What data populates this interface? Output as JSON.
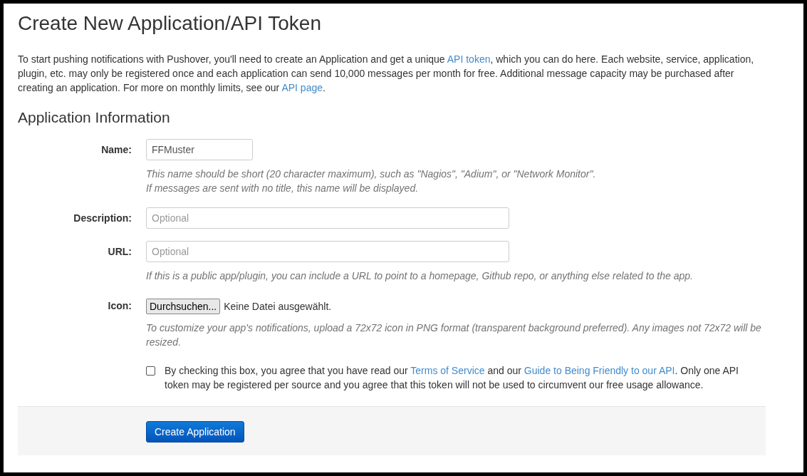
{
  "title": "Create New Application/API Token",
  "intro": [
    {
      "kind": "text",
      "text": "To start pushing notifications with Pushover, you'll need to create an Application and get a unique "
    },
    {
      "kind": "link",
      "text": "API token"
    },
    {
      "kind": "text",
      "text": ", which you can do here. Each website, service, application, plugin, etc. may only be registered once and each application can send 10,000 messages per month for free. Additional message capacity may be purchased after creating an application. For more on monthly limits, see our "
    },
    {
      "kind": "link",
      "text": "API page"
    },
    {
      "kind": "text",
      "text": "."
    }
  ],
  "section_title": "Application Information",
  "fields": [
    {
      "kind": "short",
      "label": "Name:",
      "value": "FFMuster",
      "help": [
        "This name should be short (20 character maximum), such as \"Nagios\", \"Adium\", or \"Network Monitor\".",
        "If messages are sent with no title, this name will be displayed."
      ]
    },
    {
      "kind": "text",
      "label": "Description:",
      "placeholder": "Optional"
    },
    {
      "kind": "text",
      "label": "URL:",
      "placeholder": "Optional",
      "help": [
        "If this is a public app/plugin, you can include a URL to point to a homepage, Github repo, or anything else related to the app."
      ]
    },
    {
      "kind": "file",
      "label": "Icon:",
      "button": "Durchsuchen...",
      "status": "Keine Datei ausgewählt.",
      "help": [
        "To customize your app's notifications, upload a 72x72 icon in PNG format (transparent background preferred). Any images not 72x72 will be resized."
      ]
    }
  ],
  "agreement": {
    "checked": false,
    "segments": [
      {
        "kind": "text",
        "text": "By checking this box, you agree that you have read our "
      },
      {
        "kind": "link",
        "text": "Terms of Service"
      },
      {
        "kind": "text",
        "text": " and our "
      },
      {
        "kind": "link",
        "text": "Guide to Being Friendly to our API"
      },
      {
        "kind": "text",
        "text": ". Only one API token may be registered per source and you agree that this token will not be used to circumvent our free usage allowance."
      }
    ]
  },
  "submit": "Create Application"
}
